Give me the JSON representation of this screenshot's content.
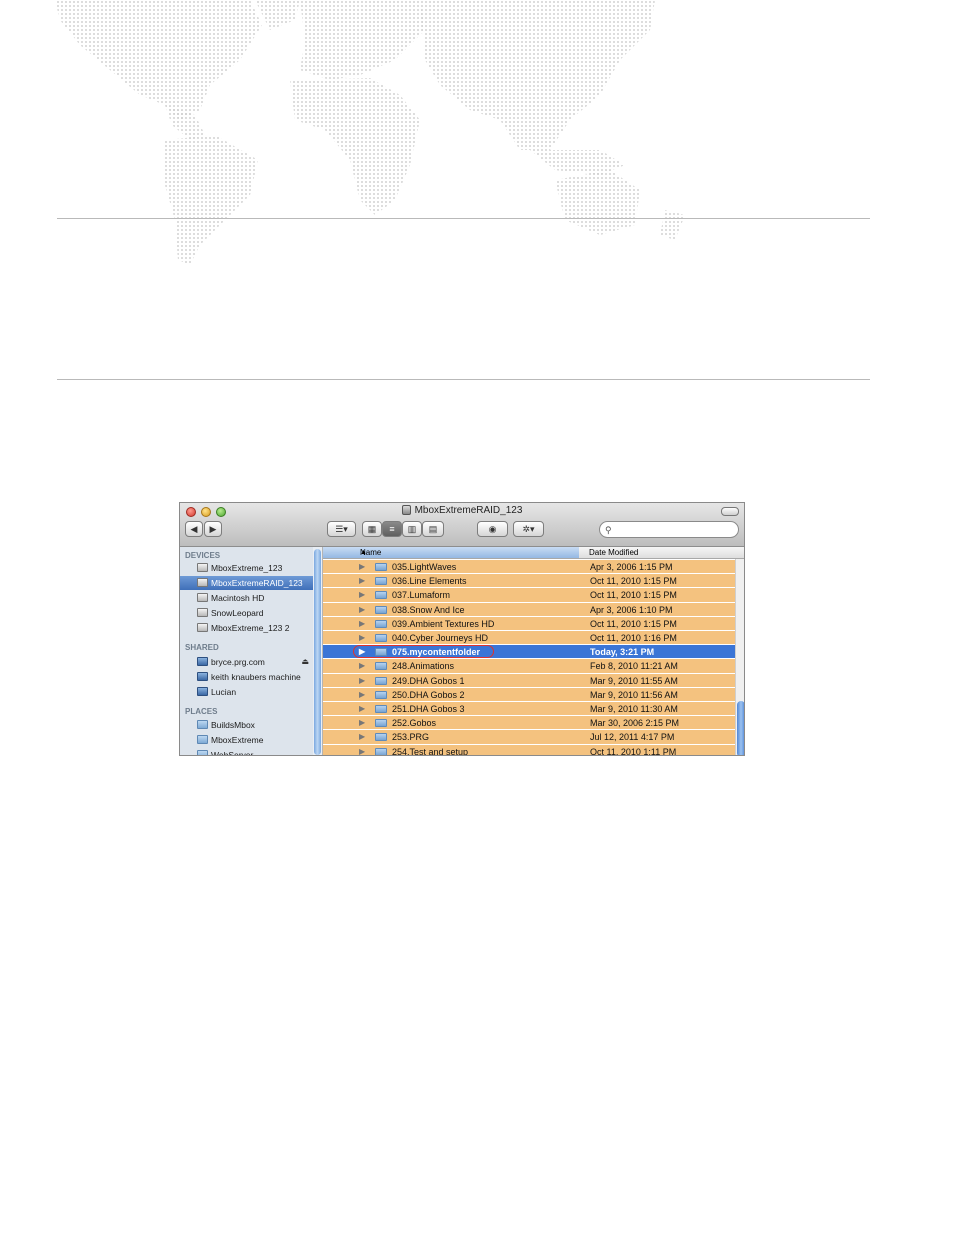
{
  "window": {
    "title": "MboxExtremeRAID_123",
    "search_placeholder": ""
  },
  "sidebar": {
    "sections": [
      {
        "label": "DEVICES",
        "items": [
          {
            "label": "MboxExtreme_123",
            "icon": "hard-drive-icon"
          },
          {
            "label": "MboxExtremeRAID_123",
            "icon": "hard-drive-icon",
            "selected": true
          },
          {
            "label": "Macintosh HD",
            "icon": "hard-drive-icon"
          },
          {
            "label": "SnowLeopard",
            "icon": "hard-drive-icon"
          },
          {
            "label": "MboxExtreme_123 2",
            "icon": "hard-drive-icon"
          }
        ]
      },
      {
        "label": "SHARED",
        "items": [
          {
            "label": "bryce.prg.com",
            "icon": "computer-icon",
            "eject": true
          },
          {
            "label": "keith knaubers machine",
            "icon": "computer-icon"
          },
          {
            "label": "Lucian",
            "icon": "computer-icon"
          }
        ]
      },
      {
        "label": "PLACES",
        "items": [
          {
            "label": "BuildsMbox",
            "icon": "folder-icon"
          },
          {
            "label": "MboxExtreme",
            "icon": "folder-icon"
          },
          {
            "label": "WebServer",
            "icon": "folder-icon"
          }
        ]
      }
    ]
  },
  "list": {
    "columns": {
      "name": "Name",
      "date": "Date Modified"
    },
    "rows": [
      {
        "name": "035.LightWaves",
        "date": "Apr 3, 2006 1:15 PM"
      },
      {
        "name": "036.Line Elements",
        "date": "Oct 11, 2010 1:15 PM"
      },
      {
        "name": "037.Lumaform",
        "date": "Oct 11, 2010 1:15 PM"
      },
      {
        "name": "038.Snow And Ice",
        "date": "Apr 3, 2006 1:10 PM"
      },
      {
        "name": "039.Ambient Textures HD",
        "date": "Oct 11, 2010 1:15 PM"
      },
      {
        "name": "040.Cyber Journeys HD",
        "date": "Oct 11, 2010 1:16 PM"
      },
      {
        "name": "075.mycontentfolder",
        "date": "Today, 3:21 PM",
        "selected": true,
        "circled": true
      },
      {
        "name": "248.Animations",
        "date": "Feb 8, 2010 11:21 AM"
      },
      {
        "name": "249.DHA Gobos 1",
        "date": "Mar 9, 2010 11:55 AM"
      },
      {
        "name": "250.DHA Gobos 2",
        "date": "Mar 9, 2010 11:56 AM"
      },
      {
        "name": "251.DHA Gobos 3",
        "date": "Mar 9, 2010 11:30 AM"
      },
      {
        "name": "252.Gobos",
        "date": "Mar 30, 2006 2:15 PM"
      },
      {
        "name": "253.PRG",
        "date": "Jul 12, 2011 4:17 PM"
      },
      {
        "name": "254.Test and setup",
        "date": "Oct 11, 2010 1:11 PM"
      }
    ]
  },
  "colors": {
    "row_highlight": "#f4c27f",
    "selection": "#3b75d6",
    "annotation_ring": "#e0322d"
  }
}
